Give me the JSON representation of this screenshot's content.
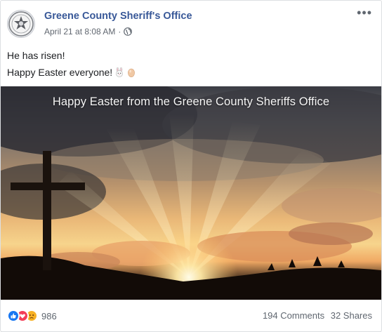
{
  "post": {
    "page_name": "Greene County Sheriff's Office",
    "date": "April 21 at 8:08 AM",
    "separator": "·",
    "privacy_icon": "globe-icon",
    "more_icon": "more-options-icon",
    "text_lines": [
      "He has risen!",
      "Happy Easter everyone!"
    ],
    "emojis": [
      "bunny-emoji",
      "egg-emoji"
    ]
  },
  "photo": {
    "overlay_text": "Happy Easter from the Greene County Sheriffs Office"
  },
  "engagement": {
    "reaction_icons": [
      "like-icon",
      "love-icon",
      "sad-icon"
    ],
    "reaction_count": "986",
    "comments": "194 Comments",
    "shares": "32 Shares"
  },
  "colors": {
    "link_blue": "#385898",
    "meta_gray": "#616770",
    "like": "#1877f2",
    "love": "#f33e58",
    "sad": "#f7b125"
  }
}
